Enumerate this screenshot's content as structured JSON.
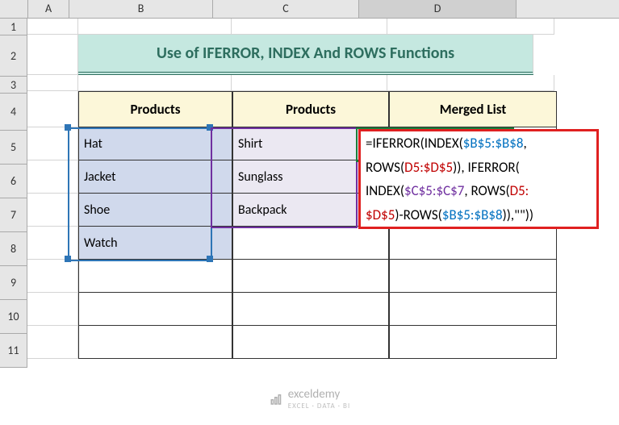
{
  "columns": [
    "A",
    "B",
    "C",
    "D"
  ],
  "rows": [
    "1",
    "2",
    "3",
    "4",
    "5",
    "6",
    "7",
    "8",
    "9",
    "10",
    "11"
  ],
  "title": "Use of IFERROR, INDEX And ROWS Functions",
  "headers": {
    "b": "Products",
    "c": "Products",
    "d": "Merged List"
  },
  "colB": [
    "Hat",
    "Jacket",
    "Shoe",
    "Watch"
  ],
  "colC": [
    "Shirt",
    "Sunglass",
    "Backpack"
  ],
  "formula": {
    "l1_a": "=IFERROR(INDEX(",
    "l1_b": "$B$5:$B$8",
    "l1_c": ",",
    "l2_a": "ROWS(",
    "l2_b": "D5:$D$5",
    "l2_c": ")), IFERROR(",
    "l3_a": "INDEX(",
    "l3_b": "$C$5:$C$7",
    "l3_c": ", ROWS(",
    "l3_d": "D5:",
    "l4_a": "$D$5",
    "l4_b": ")-ROWS(",
    "l4_c": "$B$5:$B$8",
    "l4_d": ")),\"\"))"
  },
  "watermark": {
    "text": "exceldemy",
    "sub": "EXCEL · DATA · BI"
  },
  "col_widths": {
    "corner": 34,
    "A": 50,
    "B": 177,
    "C": 180,
    "D": 194
  },
  "row_heights": {
    "header": 22,
    "r1": 20,
    "r2": 50,
    "r3": 20,
    "r4": 45,
    "default": 41
  }
}
